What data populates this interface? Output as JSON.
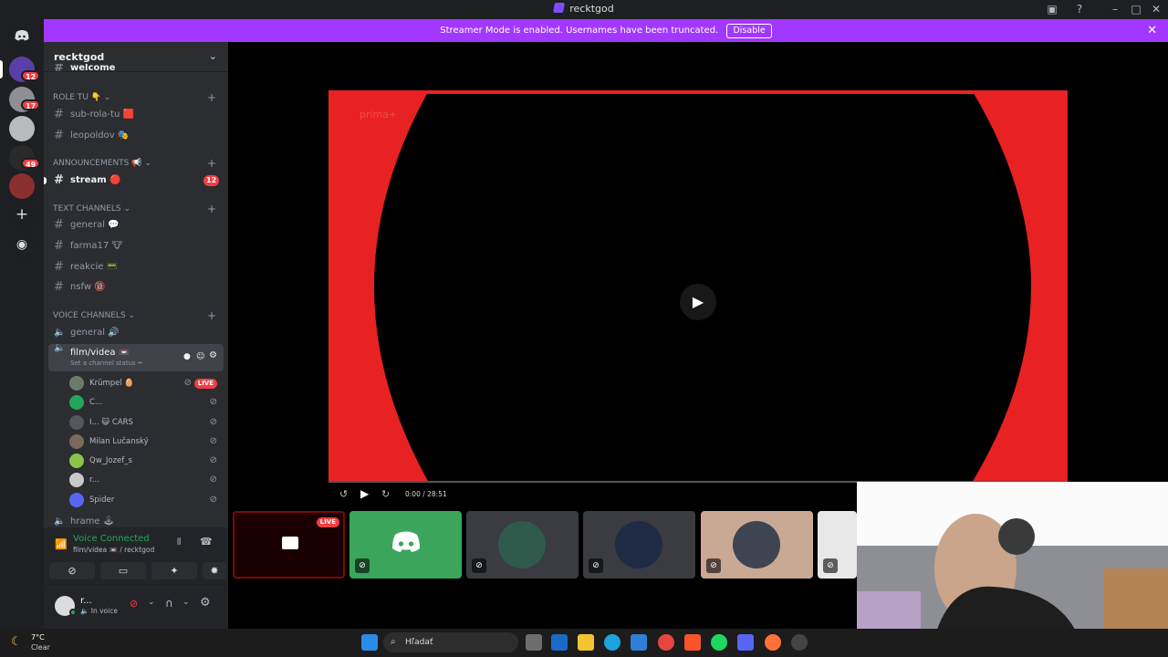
{
  "window": {
    "title": "recktgod"
  },
  "banner": {
    "text": "Streamer Mode is enabled. Usernames have been truncated.",
    "disable_label": "Disable"
  },
  "rail": {
    "badges": [
      "12",
      "17",
      "49"
    ]
  },
  "guild": {
    "name": "recktgod",
    "partial_top": "welcome"
  },
  "categories": {
    "role": "ROLE TU 👇",
    "announcements": "ANNOUNCEMENTS 📢",
    "text": "TEXT CHANNELS",
    "voice": "VOICE CHANNELS"
  },
  "channels": {
    "sub_rola": "sub-rola-tu 🟥",
    "leopoldov": "leopoldov 🎭",
    "stream": "stream 🔴",
    "stream_badge": "12",
    "general": "general 💬",
    "farma": "farma17 🐮",
    "reakcie": "reakcie 📟",
    "nsfw": "nsfw 🔞",
    "voice_general": "general 🔊",
    "film": "film/videa 📼",
    "film_status": "Set a channel status ✏",
    "partial_bottom": "hrame 🕹"
  },
  "voice_users": [
    {
      "name": "Krümpel 🥚",
      "live": "LIVE"
    },
    {
      "name": "C..."
    },
    {
      "name": "I... 😺 CARS"
    },
    {
      "name": "Milan Lučanský"
    },
    {
      "name": "Qw_Jozef_s"
    },
    {
      "name": "r..."
    },
    {
      "name": "Spider"
    }
  ],
  "voice_panel": {
    "status": "Voice Connected",
    "channel": "film/videa 📼 / recktgod"
  },
  "user_panel": {
    "name": "r...",
    "status": "In voice"
  },
  "player": {
    "time": "0:00 / 28:51",
    "watermark": "prima+"
  },
  "thumb_live": "LIVE",
  "taskbar": {
    "weather_temp": "7°C",
    "weather_text": "Clear",
    "search_placeholder": "Hľadať"
  },
  "colors": {
    "accent": "#a238ff",
    "red": "#f23f43",
    "green": "#23a55a",
    "blurple": "#5865f2"
  }
}
